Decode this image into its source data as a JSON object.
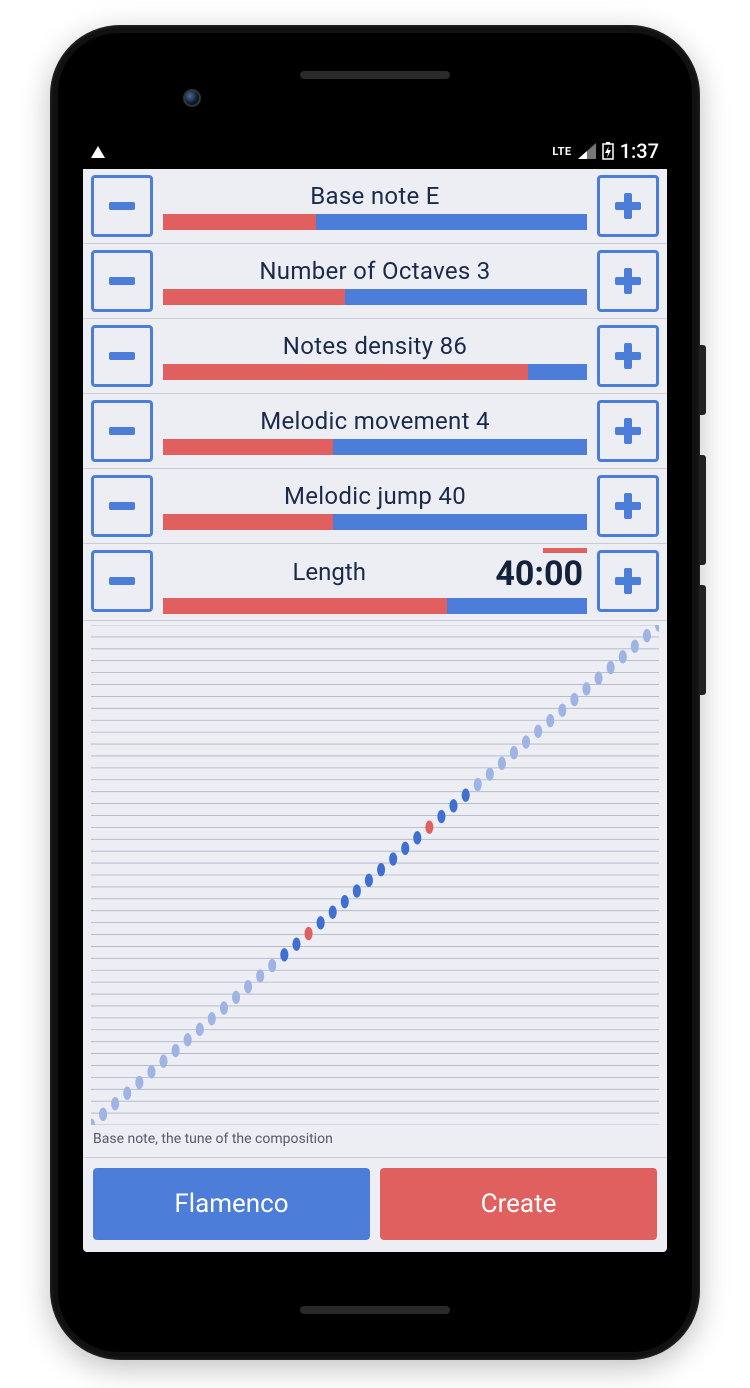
{
  "status": {
    "network_label": "LTE",
    "time": "1:37"
  },
  "params": {
    "base_note": {
      "label": "Base note E",
      "fill_pct": 36
    },
    "octaves": {
      "label": "Number of Octaves 3",
      "fill_pct": 43
    },
    "density": {
      "label": "Notes density 86",
      "fill_pct": 86
    },
    "movement": {
      "label": "Melodic movement 4",
      "fill_pct": 40
    },
    "jump": {
      "label": "Melodic jump 40",
      "fill_pct": 40
    },
    "length": {
      "label": "Length",
      "value": "40:00",
      "fill_pct": 67
    }
  },
  "caption": "Base note, the tune of the composition",
  "buttons": {
    "style": "Flamenco",
    "create": "Create"
  },
  "chart_data": {
    "type": "scatter",
    "title": "",
    "xlabel": "",
    "ylabel": "",
    "xlim": [
      0,
      47
    ],
    "ylim": [
      0,
      47
    ],
    "n_gridlines": 42,
    "series": [
      {
        "name": "faint",
        "color": "#9fb4e2",
        "points": [
          [
            0,
            0
          ],
          [
            1,
            1
          ],
          [
            2,
            2
          ],
          [
            3,
            3
          ],
          [
            4,
            4
          ],
          [
            5,
            5
          ],
          [
            6,
            6
          ],
          [
            7,
            7
          ],
          [
            8,
            8
          ],
          [
            9,
            9
          ],
          [
            10,
            10
          ],
          [
            11,
            11
          ],
          [
            12,
            12
          ],
          [
            13,
            13
          ],
          [
            14,
            14
          ],
          [
            15,
            15
          ],
          [
            32,
            32
          ],
          [
            33,
            33
          ],
          [
            34,
            34
          ],
          [
            35,
            35
          ],
          [
            36,
            36
          ],
          [
            37,
            37
          ],
          [
            38,
            38
          ],
          [
            39,
            39
          ],
          [
            40,
            40
          ],
          [
            41,
            41
          ],
          [
            42,
            42
          ],
          [
            43,
            43
          ],
          [
            44,
            44
          ],
          [
            45,
            45
          ],
          [
            46,
            46
          ],
          [
            47,
            47
          ]
        ]
      },
      {
        "name": "bright",
        "color": "#3f6fd0",
        "points": [
          [
            16,
            16
          ],
          [
            17,
            17
          ],
          [
            19,
            19
          ],
          [
            20,
            20
          ],
          [
            21,
            21
          ],
          [
            22,
            22
          ],
          [
            23,
            23
          ],
          [
            24,
            24
          ],
          [
            25,
            25
          ],
          [
            26,
            26
          ],
          [
            27,
            27
          ],
          [
            29,
            29
          ],
          [
            30,
            30
          ],
          [
            31,
            31
          ]
        ]
      },
      {
        "name": "accent",
        "color": "#e06060",
        "points": [
          [
            18,
            18
          ],
          [
            28,
            28
          ]
        ]
      }
    ]
  }
}
